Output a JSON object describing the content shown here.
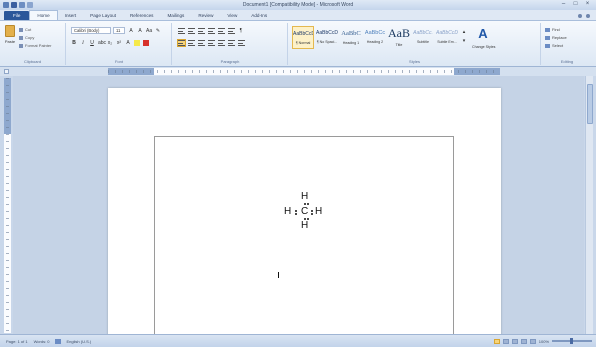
{
  "window": {
    "title": "Document1 [Compatibility Mode] - Microsoft Word"
  },
  "tabs": [
    "File",
    "Home",
    "Insert",
    "Page Layout",
    "References",
    "Mailings",
    "Review",
    "View",
    "Add-Ins"
  ],
  "clipboard": {
    "paste": "Paste",
    "cut": "Cut",
    "copy": "Copy",
    "format_painter": "Format Painter",
    "label": "Clipboard"
  },
  "font": {
    "name": "Calibri (Body)",
    "size": "11",
    "label": "Font"
  },
  "paragraph": {
    "label": "Paragraph"
  },
  "styles": {
    "label": "Styles",
    "items": [
      {
        "sample": "AaBbCcDc",
        "name": "¶ Normal"
      },
      {
        "sample": "AaBbCcDc",
        "name": "¶ No Spaci..."
      },
      {
        "sample": "AaBbC",
        "name": "Heading 1"
      },
      {
        "sample": "AaBbCc",
        "name": "Heading 2"
      },
      {
        "sample": "AaB",
        "name": "Title"
      },
      {
        "sample": "AaBbCc.",
        "name": "Subtitle"
      },
      {
        "sample": "AaBbCcDt",
        "name": "Subtle Em..."
      }
    ],
    "change_styles": "Change Styles"
  },
  "editing": {
    "find": "Find",
    "replace": "Replace",
    "select": "Select",
    "label": "Editing"
  },
  "document": {
    "atoms": {
      "top": "H",
      "left": "H",
      "center": "C",
      "right": "H",
      "bottom": "H"
    }
  },
  "status": {
    "page": "Page: 1 of 1",
    "words": "Words: 0",
    "language": "English (U.S.)",
    "zoom": "100%"
  }
}
